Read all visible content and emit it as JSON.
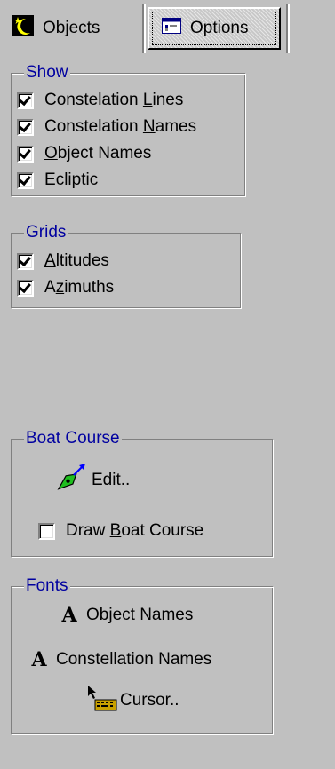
{
  "tabs": {
    "objects_label": "Objects",
    "options_label": "Options"
  },
  "show": {
    "title": "Show",
    "items": [
      {
        "pre": "Constelation ",
        "u": "L",
        "post": "ines",
        "checked": true
      },
      {
        "pre": "Constelation ",
        "u": "N",
        "post": "ames",
        "checked": true
      },
      {
        "pre": "",
        "u": "O",
        "post": "bject Names",
        "checked": true
      },
      {
        "pre": "",
        "u": "E",
        "post": "cliptic",
        "checked": true
      }
    ]
  },
  "grids": {
    "title": "Grids",
    "items": [
      {
        "pre": "",
        "u": "A",
        "post": "ltitudes",
        "checked": true
      },
      {
        "pre": "A",
        "u": "z",
        "post": "imuths",
        "checked": true
      }
    ]
  },
  "boat_course": {
    "title": "Boat Course",
    "edit_label": "Edit..",
    "draw": {
      "pre": "Draw ",
      "u": "B",
      "post": "oat Course",
      "checked": false
    }
  },
  "fonts": {
    "title": "Fonts",
    "glyph": "A",
    "object_names_label": "Object Names",
    "constellation_names_label": "Constellation Names",
    "cursor_label": "Cursor.."
  },
  "colors": {
    "face": "#c0c0c0",
    "group_title": "#0000a0",
    "boat_icon": "#1fbf1f",
    "boat_arrow": "#0000ff"
  }
}
